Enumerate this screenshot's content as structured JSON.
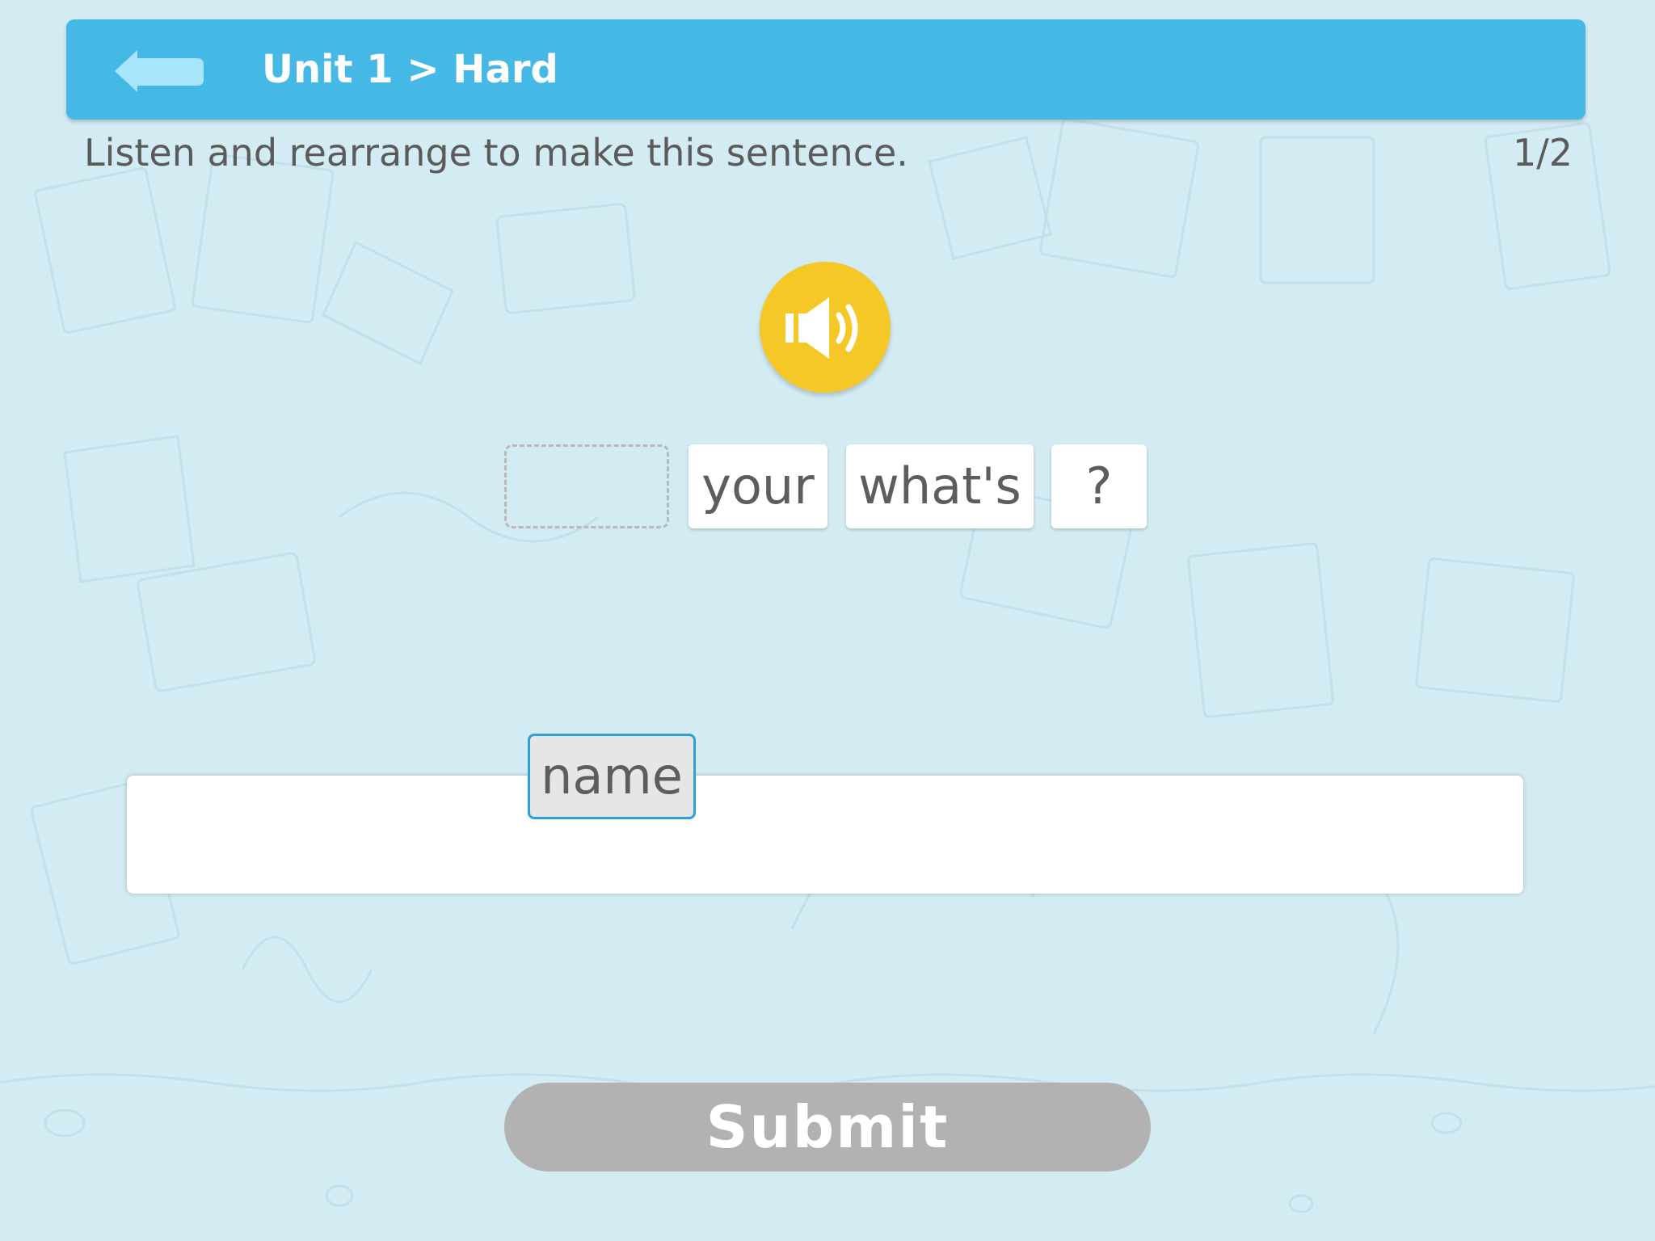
{
  "header": {
    "breadcrumb": "Unit 1 > Hard",
    "back_icon": "back-arrow-icon",
    "color": "#45b8e6"
  },
  "instruction": "Listen and rearrange to make this sentence.",
  "progress": "1/2",
  "audio_button": {
    "icon": "speaker-icon",
    "color": "#f5c828"
  },
  "sentence_tiles": [
    "your",
    "what's",
    "?"
  ],
  "dragging_tile": "name",
  "submit": {
    "label": "Submit",
    "color": "#b2b2b2"
  }
}
